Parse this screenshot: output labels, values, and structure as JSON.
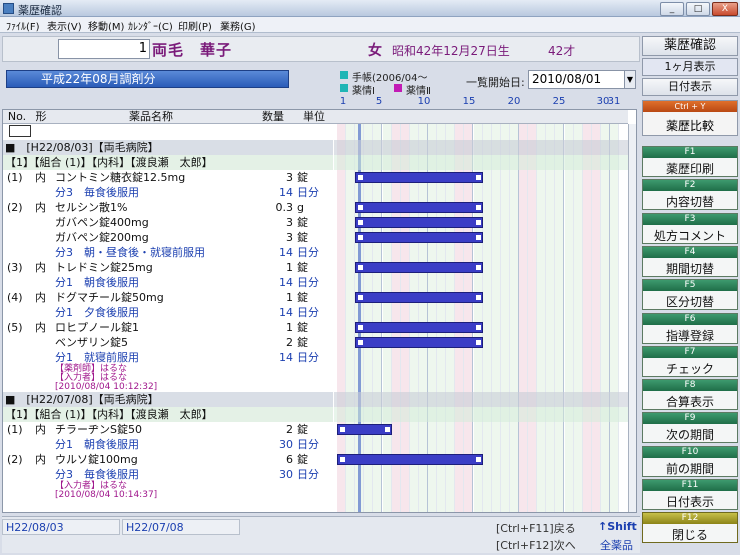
{
  "window": {
    "title": "薬歴確認",
    "min": "_",
    "max": "□",
    "close": "X"
  },
  "menu": [
    "ﾌｧｲﾙ(F)",
    "表示(V)",
    "移動(M)",
    "ｶﾚﾝﾀﾞｰ(C)",
    "印刷(P)",
    "業務(G)"
  ],
  "patient": {
    "id": "1",
    "name": "両毛　華子",
    "sex": "女",
    "dob": "昭和42年12月27日生",
    "age": "42才"
  },
  "period": {
    "label": "平成22年08月調剤分"
  },
  "legend": {
    "techou": "手帳(2006/04〜",
    "yakujo1": "薬情Ⅰ",
    "yakujo2": "薬情Ⅱ"
  },
  "start": {
    "label": "一覧開始日:",
    "value": "2010/08/01"
  },
  "columns": {
    "no": "No.",
    "form": "形",
    "name": "薬品名称",
    "qty": "数量",
    "unit": "単位"
  },
  "days": [
    "1",
    "5",
    "10",
    "15",
    "20",
    "25",
    "30",
    "31"
  ],
  "rows": [
    {
      "type": "hosp",
      "text": "■　[H22/08/03]【両毛病院】"
    },
    {
      "type": "grp",
      "text": "【1】【組合 (1)】【内科】【渡良瀬　太郎】"
    },
    {
      "type": "drug",
      "no": "(1)",
      "form": "内",
      "name": "コントミン糖衣錠12.5mg",
      "qty": "3",
      "unit": "錠",
      "bar": [
        3,
        16
      ]
    },
    {
      "type": "sched",
      "name": "分3　毎食後服用",
      "qty": "14",
      "unit": "日分"
    },
    {
      "type": "drug",
      "no": "(2)",
      "form": "内",
      "name": "セルシン散1%",
      "qty": "0.3",
      "unit": "g",
      "bar": [
        3,
        16
      ]
    },
    {
      "type": "drug",
      "no": "",
      "form": "",
      "name": "ガバペン錠400mg",
      "qty": "3",
      "unit": "錠",
      "bar": [
        3,
        16
      ]
    },
    {
      "type": "drug",
      "no": "",
      "form": "",
      "name": "ガバペン錠200mg",
      "qty": "3",
      "unit": "錠",
      "bar": [
        3,
        16
      ]
    },
    {
      "type": "sched",
      "name": "分3　朝・昼食後・就寝前服用",
      "qty": "14",
      "unit": "日分"
    },
    {
      "type": "drug",
      "no": "(3)",
      "form": "内",
      "name": "トレドミン錠25mg",
      "qty": "1",
      "unit": "錠",
      "bar": [
        3,
        16
      ]
    },
    {
      "type": "sched",
      "name": "分1　朝食後服用",
      "qty": "14",
      "unit": "日分"
    },
    {
      "type": "drug",
      "no": "(4)",
      "form": "内",
      "name": "ドグマチール錠50mg",
      "qty": "1",
      "unit": "錠",
      "bar": [
        3,
        16
      ]
    },
    {
      "type": "sched",
      "name": "分1　夕食後服用",
      "qty": "14",
      "unit": "日分"
    },
    {
      "type": "drug",
      "no": "(5)",
      "form": "内",
      "name": "ロヒプノール錠1",
      "qty": "1",
      "unit": "錠",
      "bar": [
        3,
        16
      ]
    },
    {
      "type": "drug",
      "no": "",
      "form": "",
      "name": "ベンザリン錠5",
      "qty": "2",
      "unit": "錠",
      "bar": [
        3,
        16
      ]
    },
    {
      "type": "sched",
      "name": "分1　就寝前服用",
      "qty": "14",
      "unit": "日分"
    },
    {
      "type": "note",
      "name": "【薬剤師】はるな"
    },
    {
      "type": "note",
      "name": "【入力者】はるな"
    },
    {
      "type": "note",
      "name": "[2010/08/04 10:12:32]"
    },
    {
      "type": "hosp",
      "text": "■　[H22/07/08]【両毛病院】"
    },
    {
      "type": "grp",
      "text": "【1】【組合 (1)】【内科】【渡良瀬　太郎】"
    },
    {
      "type": "drug",
      "no": "(1)",
      "form": "内",
      "name": "チラーヂンS錠50",
      "qty": "2",
      "unit": "錠",
      "bar": [
        1,
        6
      ]
    },
    {
      "type": "sched",
      "name": "分1　朝食後服用",
      "qty": "30",
      "unit": "日分"
    },
    {
      "type": "drug",
      "no": "(2)",
      "form": "内",
      "name": "ウルソ錠100mg",
      "qty": "6",
      "unit": "錠",
      "bar": [
        1,
        16
      ]
    },
    {
      "type": "sched",
      "name": "分3　毎食後服用",
      "qty": "30",
      "unit": "日分"
    },
    {
      "type": "note",
      "name": "【入力者】はるな"
    },
    {
      "type": "note",
      "name": "[2010/08/04 10:14:37]"
    }
  ],
  "right": {
    "confirm": "薬歴確認",
    "month": "1ヶ月表示",
    "daydisp": "日付表示",
    "ctrl_label": "Ctrl + Y",
    "compare": "薬歴比較",
    "fkeys": [
      {
        "key": "F1",
        "label": "薬歴印刷"
      },
      {
        "key": "F2",
        "label": "内容切替"
      },
      {
        "key": "F3",
        "label": "処方コメント"
      },
      {
        "key": "F4",
        "label": "期間切替"
      },
      {
        "key": "F5",
        "label": "区分切替"
      },
      {
        "key": "F6",
        "label": "指導登録"
      },
      {
        "key": "F7",
        "label": "チェック"
      },
      {
        "key": "F8",
        "label": "合算表示"
      },
      {
        "key": "F9",
        "label": "次の期間"
      },
      {
        "key": "F10",
        "label": "前の期間"
      },
      {
        "key": "F11",
        "label": "日付表示"
      },
      {
        "key": "F12",
        "label": "閉じる"
      }
    ]
  },
  "status": {
    "d1": "H22/08/03",
    "d2": "H22/07/08",
    "back": "[Ctrl+F11]戻る",
    "next": "[Ctrl+F12]次へ",
    "shift": "↑Shift",
    "all": "全薬品"
  },
  "colors": {
    "bar": "#3b3ec6",
    "teal": "#1fb5b5",
    "magenta": "#c21bb5",
    "accent": "#7a1b7a"
  }
}
